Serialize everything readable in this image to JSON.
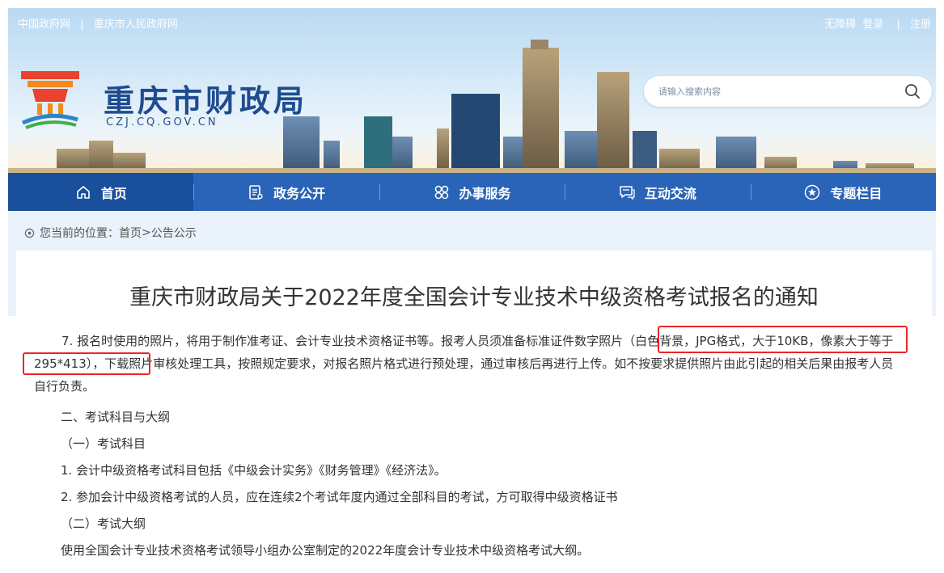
{
  "topbar": {
    "gov_link": "中国政府网",
    "separator": "|",
    "city_gov_link": "重庆市人民政府网",
    "accessibility": "无障碍",
    "login": "登录",
    "register": "注册"
  },
  "header": {
    "site_name": "重庆市财政局",
    "domain": "CZJ.CQ.GOV.CN",
    "search_placeholder": "请输入搜索内容"
  },
  "nav": {
    "items": [
      {
        "label": "首页",
        "icon": "home-icon",
        "active": true
      },
      {
        "label": "政务公开",
        "icon": "document-icon",
        "active": false
      },
      {
        "label": "办事服务",
        "icon": "grid-icon",
        "active": false
      },
      {
        "label": "互动交流",
        "icon": "chat-icon",
        "active": false
      },
      {
        "label": "专题栏目",
        "icon": "star-icon",
        "active": false
      }
    ]
  },
  "breadcrumb": {
    "prefix": "您当前的位置：",
    "home": "首页",
    "arrow": ">",
    "current": "公告公示"
  },
  "article": {
    "title": "重庆市财政局关于2022年度全国会计专业技术中级资格考试报名的通知",
    "para7_part1": "7. 报名时使用的照片，将用于制作准考证、会计专业技术资格证书等。报考人员须准备标准证件数字照片",
    "para7_highlight_a": "（白色背景，JPG格式，大于10KB，像素",
    "para7_highlight_b": "大于等于295*413）",
    "para7_part2": "，下载照片审核处理工具，按照规定要求，对报名照片格式进行预处理，通过审核后再进行上传。如不按要求提供照片由此引起的相关后果由报考人员自行负责。",
    "section2": "二、考试科目与大纲",
    "sub1": "（一）考试科目",
    "item1": "1. 会计中级资格考试科目包括《中级会计实务》《财务管理》《经济法》。",
    "item2": "2. 参加会计中级资格考试的人员，应在连续2个考试年度内通过全部科目的考试，方可取得中级资格证书",
    "sub2": "（二）考试大纲",
    "outline": "使用全国会计专业技术资格考试领导小组办公室制定的2022年度会计专业技术中级资格考试大纲。"
  },
  "colors": {
    "nav_bg": "#2a64b8",
    "nav_active": "#1a4f9c",
    "highlight_box": "#e8262a",
    "site_name": "#1f4c8f"
  }
}
